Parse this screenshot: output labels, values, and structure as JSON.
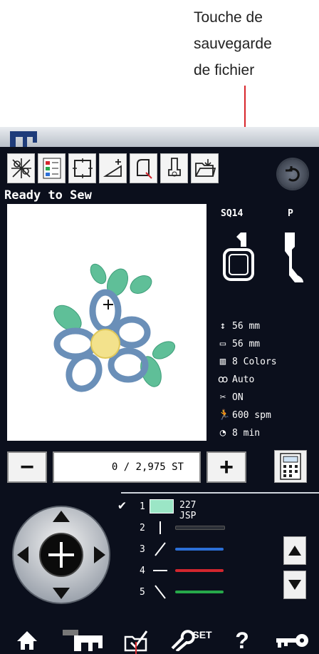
{
  "annotation": {
    "line1": "Touche de",
    "line2": "sauvegarde",
    "line3": "de fichier"
  },
  "toolbar": {
    "buttons": [
      "embroidery-edit",
      "color-list",
      "frame-trace",
      "bobbin-wind",
      "hoop-select",
      "presser-foot",
      "file-save"
    ]
  },
  "status": "Ready to Sew",
  "info": {
    "hoop": "SQ14",
    "foot": "P",
    "height": "56 mm",
    "width": "56 mm",
    "colors": "8 Colors",
    "tension": "Auto",
    "cutter": "ON",
    "speed": "600 spm",
    "time": "8 min"
  },
  "stitch_counter": {
    "minus_label": "−",
    "value": "0 / 2,975 ST",
    "plus_label": "+"
  },
  "color_list": {
    "first_code": "227 JSP",
    "numbers": [
      "1",
      "2",
      "3",
      "4",
      "5"
    ],
    "bar_colors": [
      "#2b2f37",
      "#2c6fd6",
      "#d3262e",
      "#27a84a"
    ]
  },
  "bottom_bar": {
    "set_label": "SET",
    "help_label": "?"
  },
  "colors": {
    "annotation_line": "#d8262c",
    "screen_bg": "#0b0f1c",
    "flower_petal": "#6a8fb8",
    "flower_leaf": "#5fbf98",
    "flower_center": "#f3e28c"
  }
}
